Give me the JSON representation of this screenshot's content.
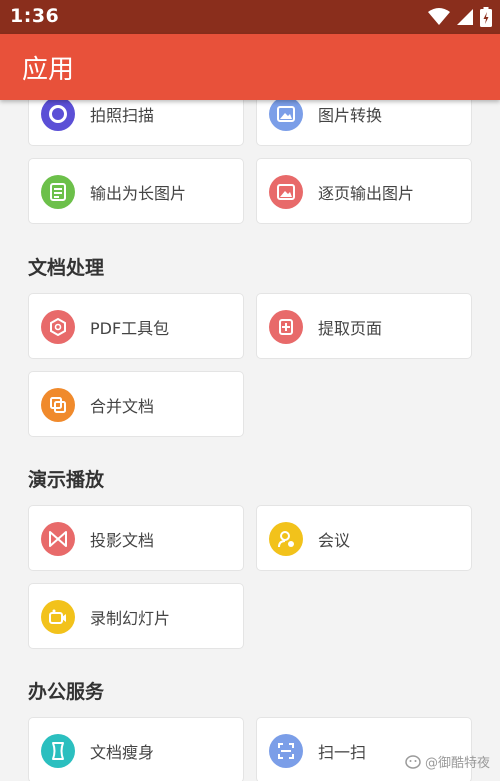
{
  "status_bar": {
    "time": "1:36"
  },
  "app_bar": {
    "title": "应用"
  },
  "colors": {
    "status_bar": "#8a2e1c",
    "app_bar": "#e8513a",
    "purple": "#5b4fd6",
    "blue": "#7b9ee8",
    "green": "#6cc04a",
    "red": "#e86a6a",
    "orange": "#f08a2c",
    "yellow": "#f2c21b",
    "teal": "#2bbfbf"
  },
  "sections": [
    {
      "title": "文档处理"
    },
    {
      "title": "演示播放"
    },
    {
      "title": "办公服务"
    }
  ],
  "cards": [
    {
      "label": "拍照扫描",
      "icon": "camera-scan-icon"
    },
    {
      "label": "图片转换",
      "icon": "image-convert-icon"
    },
    {
      "label": "输出为长图片",
      "icon": "long-image-icon"
    },
    {
      "label": "逐页输出图片",
      "icon": "page-images-icon"
    },
    {
      "label": "PDF工具包",
      "icon": "pdf-toolkit-icon"
    },
    {
      "label": "提取页面",
      "icon": "extract-page-icon"
    },
    {
      "label": "合并文档",
      "icon": "merge-docs-icon"
    },
    {
      "label": "投影文档",
      "icon": "projection-icon"
    },
    {
      "label": "会议",
      "icon": "meeting-icon"
    },
    {
      "label": "录制幻灯片",
      "icon": "record-slides-icon"
    },
    {
      "label": "文档瘦身",
      "icon": "slim-doc-icon"
    },
    {
      "label": "扫一扫",
      "icon": "scan-icon"
    }
  ],
  "watermark": {
    "text": "@御酷特夜"
  }
}
